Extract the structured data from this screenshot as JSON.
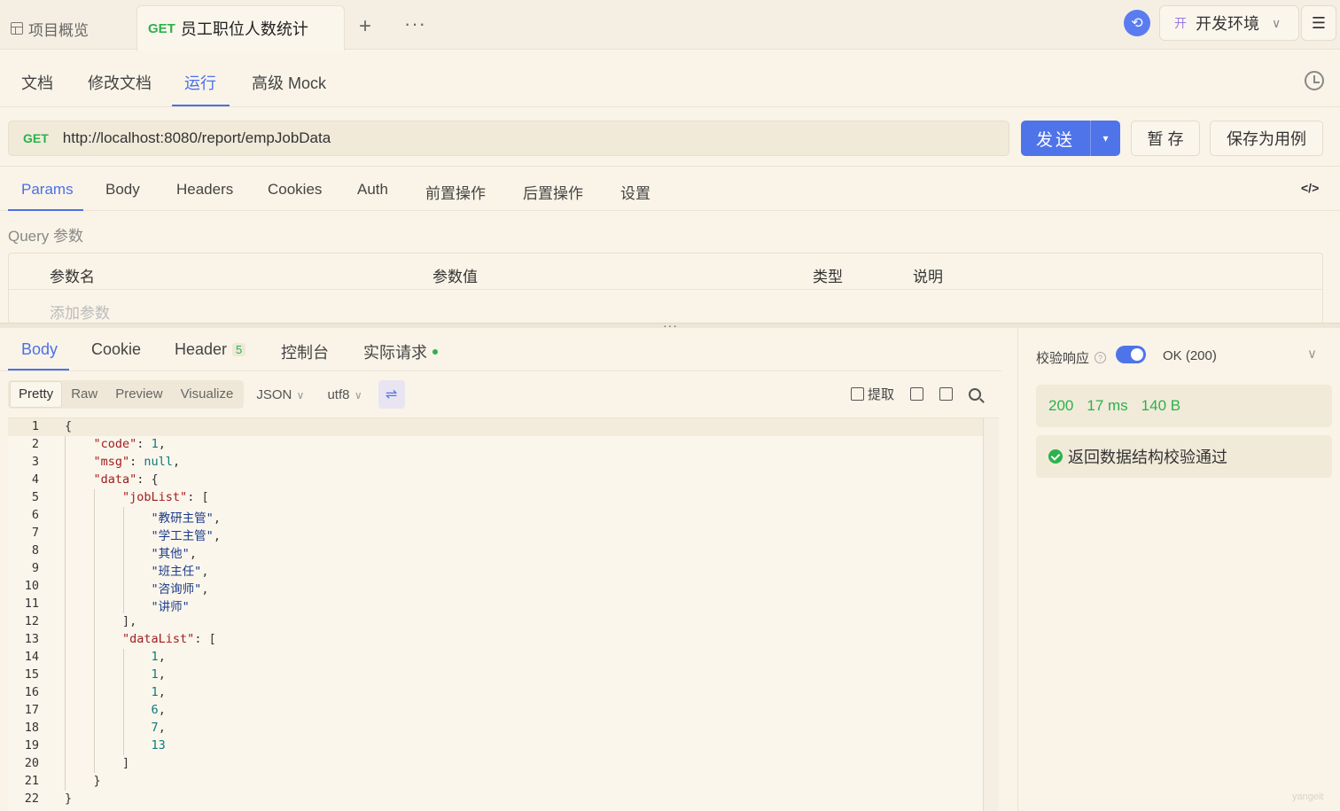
{
  "topbar": {
    "overview_label": "项目概览",
    "active_tab": {
      "method": "GET",
      "title": "员工职位人数统计"
    },
    "plus": "+",
    "more": "···",
    "env": {
      "badge": "开",
      "label": "开发环境"
    }
  },
  "subnav": {
    "items": [
      "文档",
      "修改文档",
      "运行",
      "高级 Mock"
    ],
    "active": "运行"
  },
  "request": {
    "method": "GET",
    "url": "http://localhost:8080/report/empJobData",
    "send_label": "发送",
    "save_temp_label": "暂 存",
    "save_case_label": "保存为用例"
  },
  "request_tabs": {
    "items": [
      "Params",
      "Body",
      "Headers",
      "Cookies",
      "Auth",
      "前置操作",
      "后置操作",
      "设置"
    ],
    "active": "Params"
  },
  "query": {
    "title": "Query 参数",
    "columns": [
      "参数名",
      "参数值",
      "类型",
      "说明"
    ],
    "add_placeholder": "添加参数"
  },
  "response_tabs": {
    "items": [
      "Body",
      "Cookie",
      "Header",
      "控制台",
      "实际请求"
    ],
    "header_count": "5",
    "active": "Body"
  },
  "format_bar": {
    "modes": [
      "Pretty",
      "Raw",
      "Preview",
      "Visualize"
    ],
    "active": "Pretty",
    "language": "JSON",
    "encoding": "utf8",
    "extract_label": "提取"
  },
  "code_lines": [
    "{",
    "    \"code\": 1,",
    "    \"msg\": null,",
    "    \"data\": {",
    "        \"jobList\": [",
    "            \"教研主管\",",
    "            \"学工主管\",",
    "            \"其他\",",
    "            \"班主任\",",
    "            \"咨询师\",",
    "            \"讲师\"",
    "        ],",
    "        \"dataList\": [",
    "            1,",
    "            1,",
    "            1,",
    "            6,",
    "            7,",
    "            13",
    "        ]",
    "    }",
    "}"
  ],
  "validation": {
    "label": "校验响应",
    "status": "OK (200)",
    "code": "200",
    "time": "17 ms",
    "size": "140 B",
    "result": "返回数据结构校验通过"
  },
  "watermark": "yangeit",
  "colors": {
    "accent": "#4f74ea",
    "success": "#2bb24c",
    "background": "#faf4e8"
  }
}
